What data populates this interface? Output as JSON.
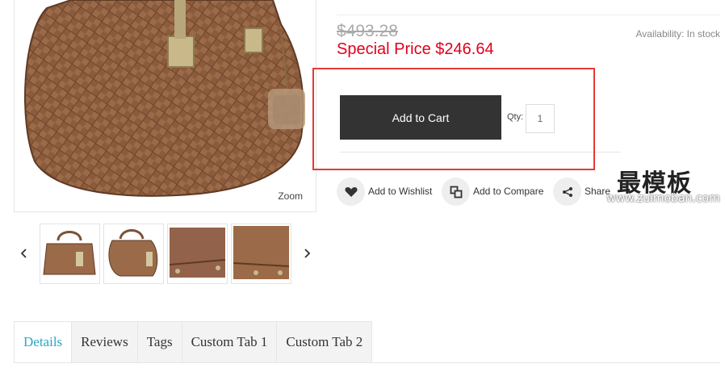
{
  "gallery": {
    "zoom_label": "Zoom",
    "prev_icon": "chevron-left-icon",
    "next_icon": "chevron-right-icon",
    "thumbnails": [
      "thumbnail-front",
      "thumbnail-side",
      "thumbnail-base-corner",
      "thumbnail-base-detail"
    ]
  },
  "product": {
    "old_price": "$493.28",
    "special_price": "Special Price $246.64",
    "availability": "Availability: In stock"
  },
  "cart": {
    "add_to_cart_label": "Add to Cart",
    "qty_label": "Qty:",
    "qty_value": "1"
  },
  "actions": {
    "wishlist_label": "Add to Wishlist",
    "compare_label": "Add to Compare",
    "share_label": "Share"
  },
  "watermark": {
    "title": "最模板",
    "url": "www.zuimoban.com"
  },
  "tabs": [
    {
      "label": "Details"
    },
    {
      "label": "Reviews"
    },
    {
      "label": "Tags"
    },
    {
      "label": "Custom Tab 1"
    },
    {
      "label": "Custom Tab 2"
    }
  ],
  "colors": {
    "special_price": "#e0001b",
    "active_tab": "#2aa6c4",
    "cart_button": "#333333",
    "highlight_box": "#e53935"
  }
}
